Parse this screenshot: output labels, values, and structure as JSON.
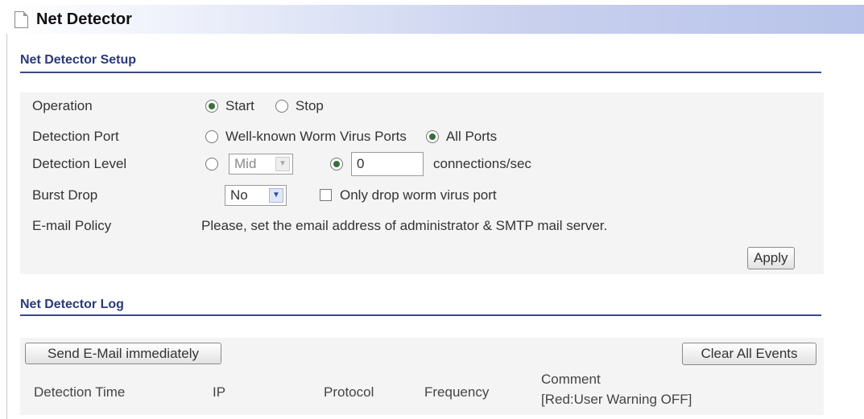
{
  "window": {
    "title": "Net Detector"
  },
  "setup": {
    "section_title": "Net Detector Setup",
    "operation": {
      "label": "Operation",
      "start_label": "Start",
      "stop_label": "Stop",
      "selected": "Start"
    },
    "detection_port": {
      "label": "Detection Port",
      "well_known_label": "Well-known Worm Virus Ports",
      "all_label": "All Ports",
      "selected": "All Ports"
    },
    "detection_level": {
      "label": "Detection Level",
      "level_select_value": "Mid",
      "threshold_value": "0",
      "unit_label": "connections/sec",
      "selected": "custom"
    },
    "burst_drop": {
      "label": "Burst Drop",
      "select_value": "No",
      "only_drop_label": "Only drop worm virus port",
      "only_drop_checked": false
    },
    "email_policy": {
      "label": "E-mail Policy",
      "message": "Please, set the email address of administrator & SMTP mail server."
    },
    "apply_label": "Apply"
  },
  "log": {
    "section_title": "Net Detector Log",
    "send_email_label": "Send E-Mail immediately",
    "clear_label": "Clear All Events",
    "columns": {
      "detection_time": "Detection Time",
      "ip": "IP",
      "protocol": "Protocol",
      "frequency": "Frequency",
      "comment": "Comment",
      "comment_note": "[Red:User Warning OFF]"
    }
  },
  "colors": {
    "section_title": "#2a3a78",
    "rule": "#3b4a86",
    "panel_bg": "#f4f4f4"
  }
}
